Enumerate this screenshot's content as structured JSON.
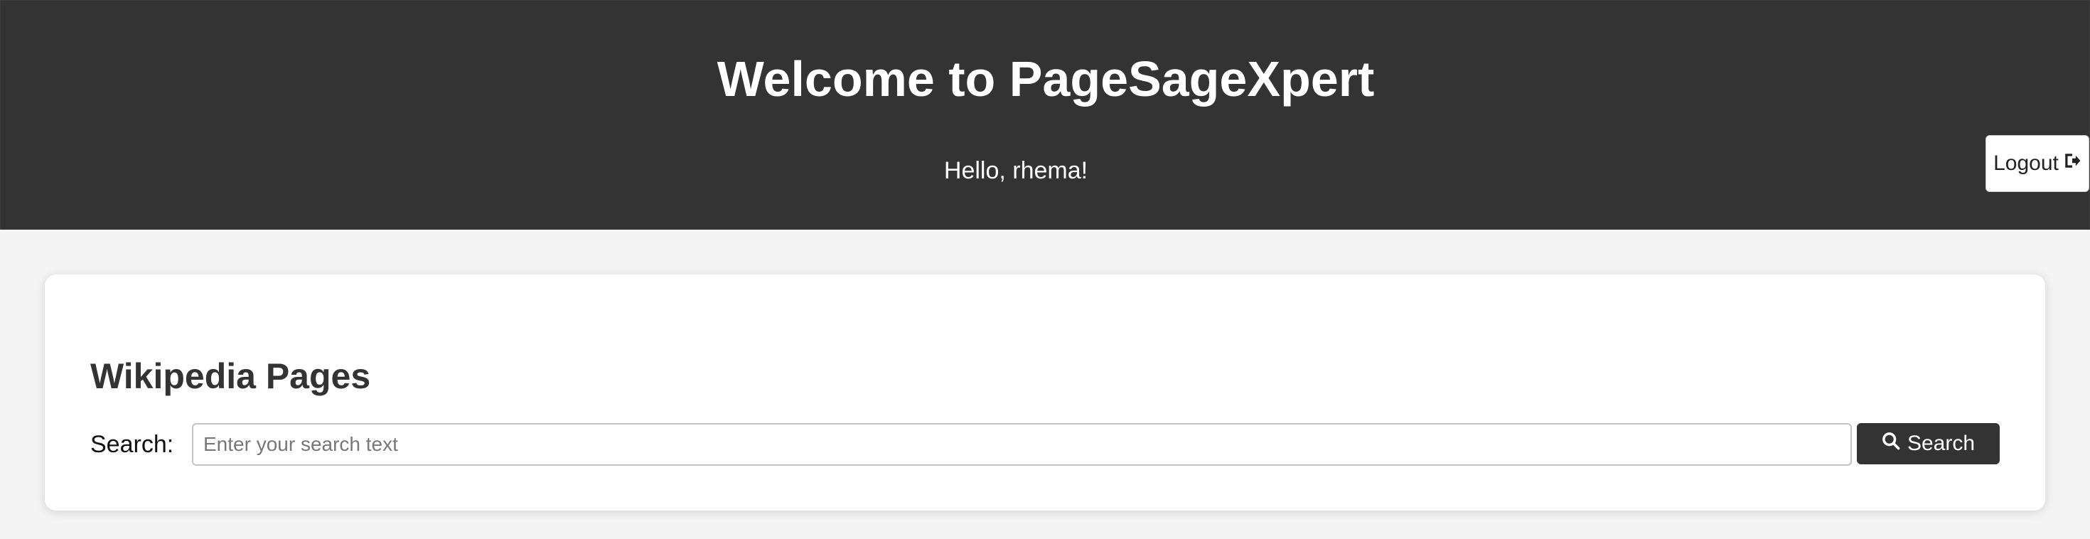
{
  "header": {
    "title": "Welcome to PageSageXpert",
    "greeting": "Hello, rhema!",
    "logout_label": "Logout",
    "logout_icon": "sign-out-icon",
    "background_color": "#333333"
  },
  "main": {
    "heading": "Wikipedia Pages",
    "search": {
      "label": "Search:",
      "placeholder": "Enter your search text",
      "value": "",
      "button_label": "Search",
      "button_icon": "search-icon"
    }
  },
  "colors": {
    "page_background": "#f4f4f4",
    "header_background": "#333333",
    "button_background": "#333333",
    "heading_text": "#333333"
  }
}
